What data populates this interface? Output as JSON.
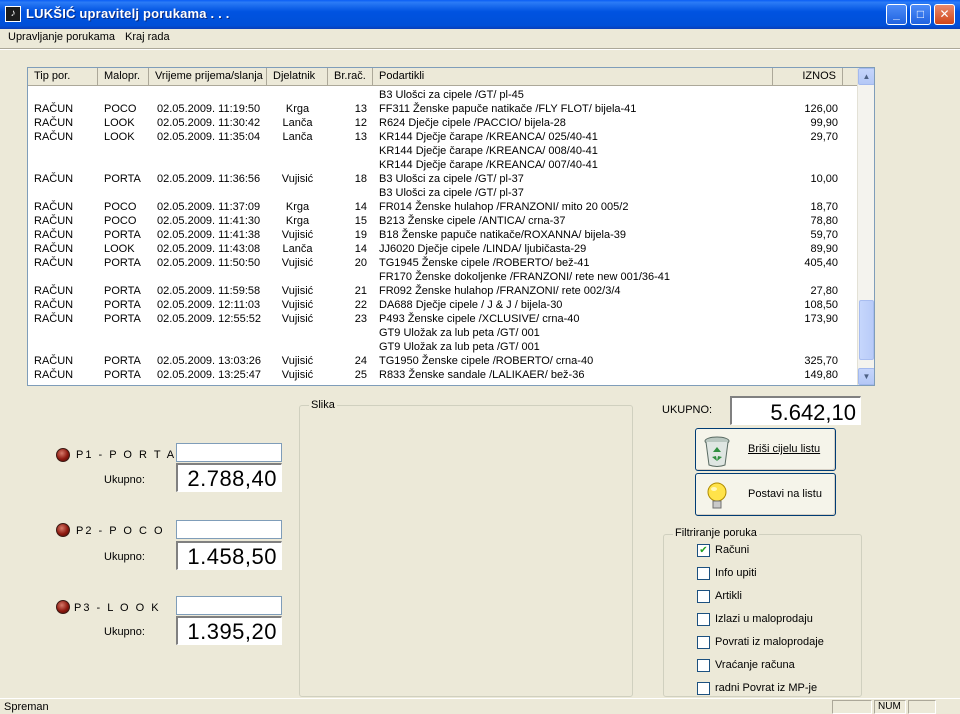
{
  "window": {
    "title": "LUKŠIĆ upravitelj porukama . . .",
    "app_icon_glyph": "♪",
    "minimize_glyph": "_",
    "maximize_glyph": "□",
    "close_glyph": "✕"
  },
  "menu": {
    "items": [
      "Upravljanje porukama",
      "Kraj rada"
    ]
  },
  "table": {
    "columns": [
      "Tip por.",
      "Malopr.",
      "Vrijeme prijema/slanja",
      "Djelatnik",
      "Br.rač.",
      "Podartikli",
      "IZNOS"
    ],
    "rows": [
      [
        "",
        "",
        "",
        "",
        "",
        "B3 Ulošci za cipele /GT/ pl-45",
        ""
      ],
      [
        "RAČUN",
        "POCO",
        "02.05.2009. 11:19:50",
        "Krga",
        "13",
        "FF311 Ženske papuče natikače /FLY FLOT/ bijela-41",
        "126,00"
      ],
      [
        "RAČUN",
        "LOOK",
        "02.05.2009. 11:30:42",
        "Lanča",
        "12",
        "R624 Dječje cipele /PACCIO/ bijela-28",
        "99,90"
      ],
      [
        "RAČUN",
        "LOOK",
        "02.05.2009. 11:35:04",
        "Lanča",
        "13",
        "KR144 Dječje čarape /KREANCA/ 025/40-41",
        "29,70"
      ],
      [
        "",
        "",
        "",
        "",
        "",
        "KR144 Dječje čarape /KREANCA/ 008/40-41",
        ""
      ],
      [
        "",
        "",
        "",
        "",
        "",
        "KR144 Dječje čarape /KREANCA/ 007/40-41",
        ""
      ],
      [
        "RAČUN",
        "PORTA",
        "02.05.2009. 11:36:56",
        "Vujisić",
        "18",
        "B3 Ulošci za cipele /GT/ pl-37",
        "10,00"
      ],
      [
        "",
        "",
        "",
        "",
        "",
        "B3 Ulošci za cipele /GT/ pl-37",
        ""
      ],
      [
        "RAČUN",
        "POCO",
        "02.05.2009. 11:37:09",
        "Krga",
        "14",
        "FR014 Ženske hulahop /FRANZONI/ mito 20 005/2",
        "18,70"
      ],
      [
        "RAČUN",
        "POCO",
        "02.05.2009. 11:41:30",
        "Krga",
        "15",
        "B213 Ženske cipele /ANTICA/ crna-37",
        "78,80"
      ],
      [
        "RAČUN",
        "PORTA",
        "02.05.2009. 11:41:38",
        "Vujisić",
        "19",
        "B18 Ženske papuče natikače/ROXANNA/ bijela-39",
        "59,70"
      ],
      [
        "RAČUN",
        "LOOK",
        "02.05.2009. 11:43:08",
        "Lanča",
        "14",
        "JJ6020 Dječje cipele /LINDA/ ljubičasta-29",
        "89,90"
      ],
      [
        "RAČUN",
        "PORTA",
        "02.05.2009. 11:50:50",
        "Vujisić",
        "20",
        "TG1945 Ženske cipele /ROBERTO/ bež-41",
        "405,40"
      ],
      [
        "",
        "",
        "",
        "",
        "",
        "FR170 Ženske dokoljenke /FRANZONI/ rete new 001/36-41",
        ""
      ],
      [
        "RAČUN",
        "PORTA",
        "02.05.2009. 11:59:58",
        "Vujisić",
        "21",
        "FR092 Ženske hulahop /FRANZONI/ rete 002/3/4",
        "27,80"
      ],
      [
        "RAČUN",
        "PORTA",
        "02.05.2009. 12:11:03",
        "Vujisić",
        "22",
        "DA688 Dječje cipele / J & J / bijela-30",
        "108,50"
      ],
      [
        "RAČUN",
        "PORTA",
        "02.05.2009. 12:55:52",
        "Vujisić",
        "23",
        "P493 Ženske cipele /XCLUSIVE/ crna-40",
        "173,90"
      ],
      [
        "",
        "",
        "",
        "",
        "",
        "GT9 Uložak za lub peta /GT/ 001",
        ""
      ],
      [
        "",
        "",
        "",
        "",
        "",
        "GT9 Uložak za lub peta /GT/ 001",
        ""
      ],
      [
        "RAČUN",
        "PORTA",
        "02.05.2009. 13:03:26",
        "Vujisić",
        "24",
        "TG1950 Ženske cipele /ROBERTO/ crna-40",
        "325,70"
      ],
      [
        "RAČUN",
        "PORTA",
        "02.05.2009. 13:25:47",
        "Vujisić",
        "25",
        "R833 Ženske sandale /LALIKAER/ bež-36",
        "149,80"
      ]
    ],
    "scroll_up_glyph": "▲",
    "scroll_down_glyph": "▼"
  },
  "stores": [
    {
      "label": "P1 - P O R T A",
      "total_label": "Ukupno:",
      "total": "2.788,40"
    },
    {
      "label": "P2 - P O C O",
      "total_label": "Ukupno:",
      "total": "1.458,50"
    },
    {
      "label": "P3 - L O O K",
      "total_label": "Ukupno:",
      "total": "1.395,20"
    }
  ],
  "image_group": {
    "title": "Slika"
  },
  "grand_total": {
    "label": "UKUPNO:",
    "value": "5.642,10"
  },
  "buttons": {
    "clear_list": "Briši cijelu listu",
    "set_list": "Postavi na listu"
  },
  "filter": {
    "title": "Filtriranje poruka",
    "options": [
      {
        "label": "Računi",
        "checked": true
      },
      {
        "label": "Info upiti",
        "checked": false
      },
      {
        "label": "Artikli",
        "checked": false
      },
      {
        "label": "Izlazi u maloprodaju",
        "checked": false
      },
      {
        "label": "Povrati iz maloprodaje",
        "checked": false
      },
      {
        "label": "Vraćanje računa",
        "checked": false
      },
      {
        "label": "radni Povrat iz MP-je",
        "checked": false
      }
    ],
    "check_glyph": "✔"
  },
  "status": {
    "text": "Spreman",
    "num": "NUM"
  }
}
